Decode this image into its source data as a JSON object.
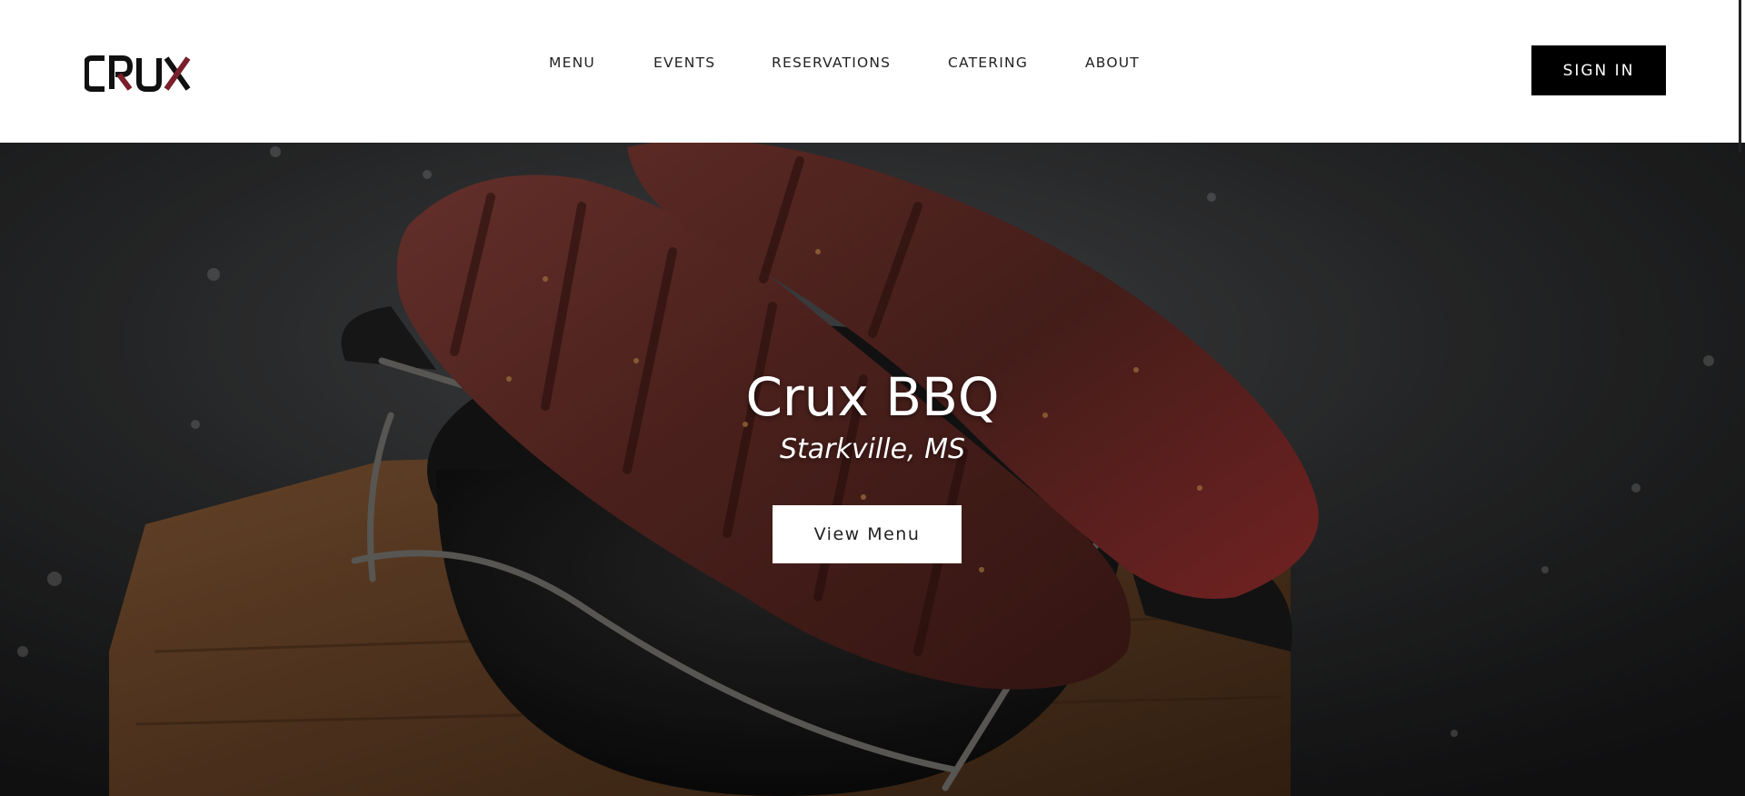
{
  "header": {
    "logo_text": "CRUX",
    "nav": [
      {
        "label": "MENU"
      },
      {
        "label": "EVENTS"
      },
      {
        "label": "RESERVATIONS"
      },
      {
        "label": "CATERING"
      },
      {
        "label": "ABOUT"
      }
    ],
    "signin_label": "SIGN IN"
  },
  "hero": {
    "title": "Crux BBQ",
    "subtitle": "Starkville, MS",
    "button_label": "View Menu",
    "image_icon": "grilled-steak-photo"
  },
  "colors": {
    "header_bg": "#ffffff",
    "signin_bg": "#000000",
    "hero_text": "#ffffff",
    "logo_accent": "#7a1f2b"
  }
}
